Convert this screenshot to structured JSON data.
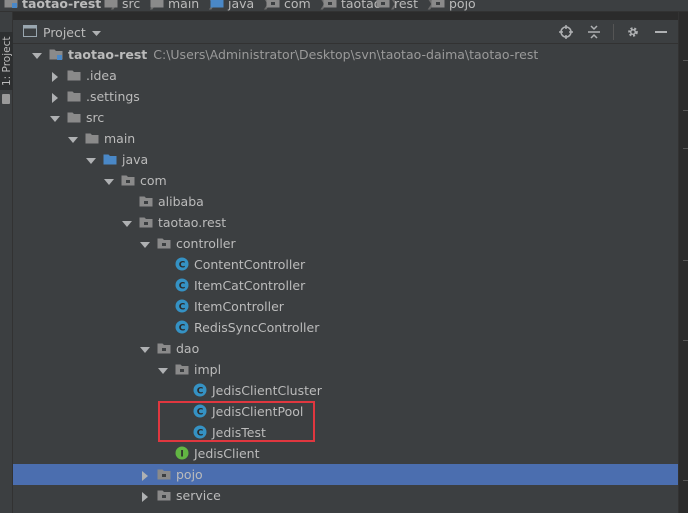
{
  "breadcrumb": [
    {
      "label": "taotao-rest",
      "icon": "module-folder-icon",
      "bold": true
    },
    {
      "label": "src",
      "icon": "folder-icon"
    },
    {
      "label": "main",
      "icon": "folder-icon"
    },
    {
      "label": "java",
      "icon": "source-folder-icon"
    },
    {
      "label": "com",
      "icon": "package-icon"
    },
    {
      "label": "taotao",
      "icon": "package-icon"
    },
    {
      "label": "rest",
      "icon": "package-icon"
    },
    {
      "label": "pojo",
      "icon": "package-icon"
    }
  ],
  "side_tab": {
    "label": "1: Project"
  },
  "tool_window": {
    "title": "Project",
    "actions": [
      "locate-icon",
      "collapse-all-icon",
      "settings-icon",
      "hide-icon"
    ]
  },
  "tree": [
    {
      "label": "taotao-rest",
      "path": "C:\\Users\\Administrator\\Desktop\\svn\\taotao-daima\\taotao-rest",
      "depth": 0,
      "state": "expanded",
      "icon": "module-folder-icon",
      "bold": true
    },
    {
      "label": ".idea",
      "depth": 1,
      "state": "collapsed",
      "icon": "folder-icon"
    },
    {
      "label": ".settings",
      "depth": 1,
      "state": "collapsed",
      "icon": "folder-icon"
    },
    {
      "label": "src",
      "depth": 1,
      "state": "expanded",
      "icon": "folder-icon"
    },
    {
      "label": "main",
      "depth": 2,
      "state": "expanded",
      "icon": "folder-icon"
    },
    {
      "label": "java",
      "depth": 3,
      "state": "expanded",
      "icon": "source-folder-icon"
    },
    {
      "label": "com",
      "depth": 4,
      "state": "expanded",
      "icon": "package-icon"
    },
    {
      "label": "alibaba",
      "depth": 5,
      "state": "none",
      "icon": "package-icon"
    },
    {
      "label": "taotao.rest",
      "depth": 5,
      "state": "expanded",
      "icon": "package-icon"
    },
    {
      "label": "controller",
      "depth": 6,
      "state": "expanded",
      "icon": "package-icon"
    },
    {
      "label": "ContentController",
      "depth": 7,
      "state": "none",
      "icon": "class-icon"
    },
    {
      "label": "ItemCatController",
      "depth": 7,
      "state": "none",
      "icon": "class-icon"
    },
    {
      "label": "ItemController",
      "depth": 7,
      "state": "none",
      "icon": "class-icon"
    },
    {
      "label": "RedisSyncController",
      "depth": 7,
      "state": "none",
      "icon": "class-icon"
    },
    {
      "label": "dao",
      "depth": 6,
      "state": "expanded",
      "icon": "package-icon"
    },
    {
      "label": "impl",
      "depth": 7,
      "state": "expanded",
      "icon": "package-icon"
    },
    {
      "label": "JedisClientCluster",
      "depth": 8,
      "state": "none",
      "icon": "class-icon"
    },
    {
      "label": "JedisClientPool",
      "depth": 8,
      "state": "none",
      "icon": "class-icon"
    },
    {
      "label": "JedisTest",
      "depth": 8,
      "state": "none",
      "icon": "class-icon"
    },
    {
      "label": "JedisClient",
      "depth": 7,
      "state": "none",
      "icon": "interface-icon"
    },
    {
      "label": "pojo",
      "depth": 6,
      "state": "collapsed",
      "icon": "package-icon",
      "selected": true
    },
    {
      "label": "service",
      "depth": 6,
      "state": "collapsed",
      "icon": "package-icon"
    }
  ],
  "colors": {
    "panel": "#3c3f41",
    "selection": "#4b6eaf",
    "folder": "#8a8a8a",
    "source_folder": "#4a88c7",
    "class_badge": "#3592c4",
    "interface_badge": "#62b543",
    "highlight_box": "#e0373f"
  }
}
